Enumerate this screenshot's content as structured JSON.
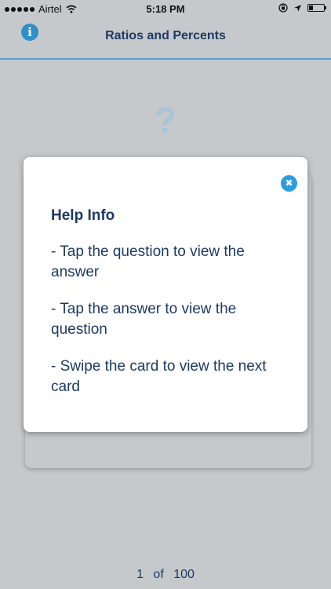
{
  "status_bar": {
    "carrier": "Airtel",
    "time": "5:18 PM"
  },
  "nav": {
    "title": "Ratios and Percents",
    "info_icon_glyph": "i"
  },
  "card": {
    "placeholder_glyph": "?"
  },
  "help_modal": {
    "title": "Help Info",
    "close_glyph": "✖",
    "items": [
      "- Tap the question to view the answer",
      "- Tap the answer to view the question",
      "- Swipe the card to view the next card"
    ]
  },
  "pagination": {
    "current": "1",
    "separator": "of",
    "total": "100"
  },
  "icons": {
    "info": "info-icon",
    "close": "close-icon",
    "wifi": "wifi-icon",
    "location": "location-icon",
    "orientation_lock": "orientation-lock-icon",
    "battery": "battery-icon"
  },
  "colors": {
    "accent": "#2f8fca",
    "title_text": "#1d3a63",
    "background": "#c6c9cc",
    "nav_divider": "#5aa1d1"
  }
}
